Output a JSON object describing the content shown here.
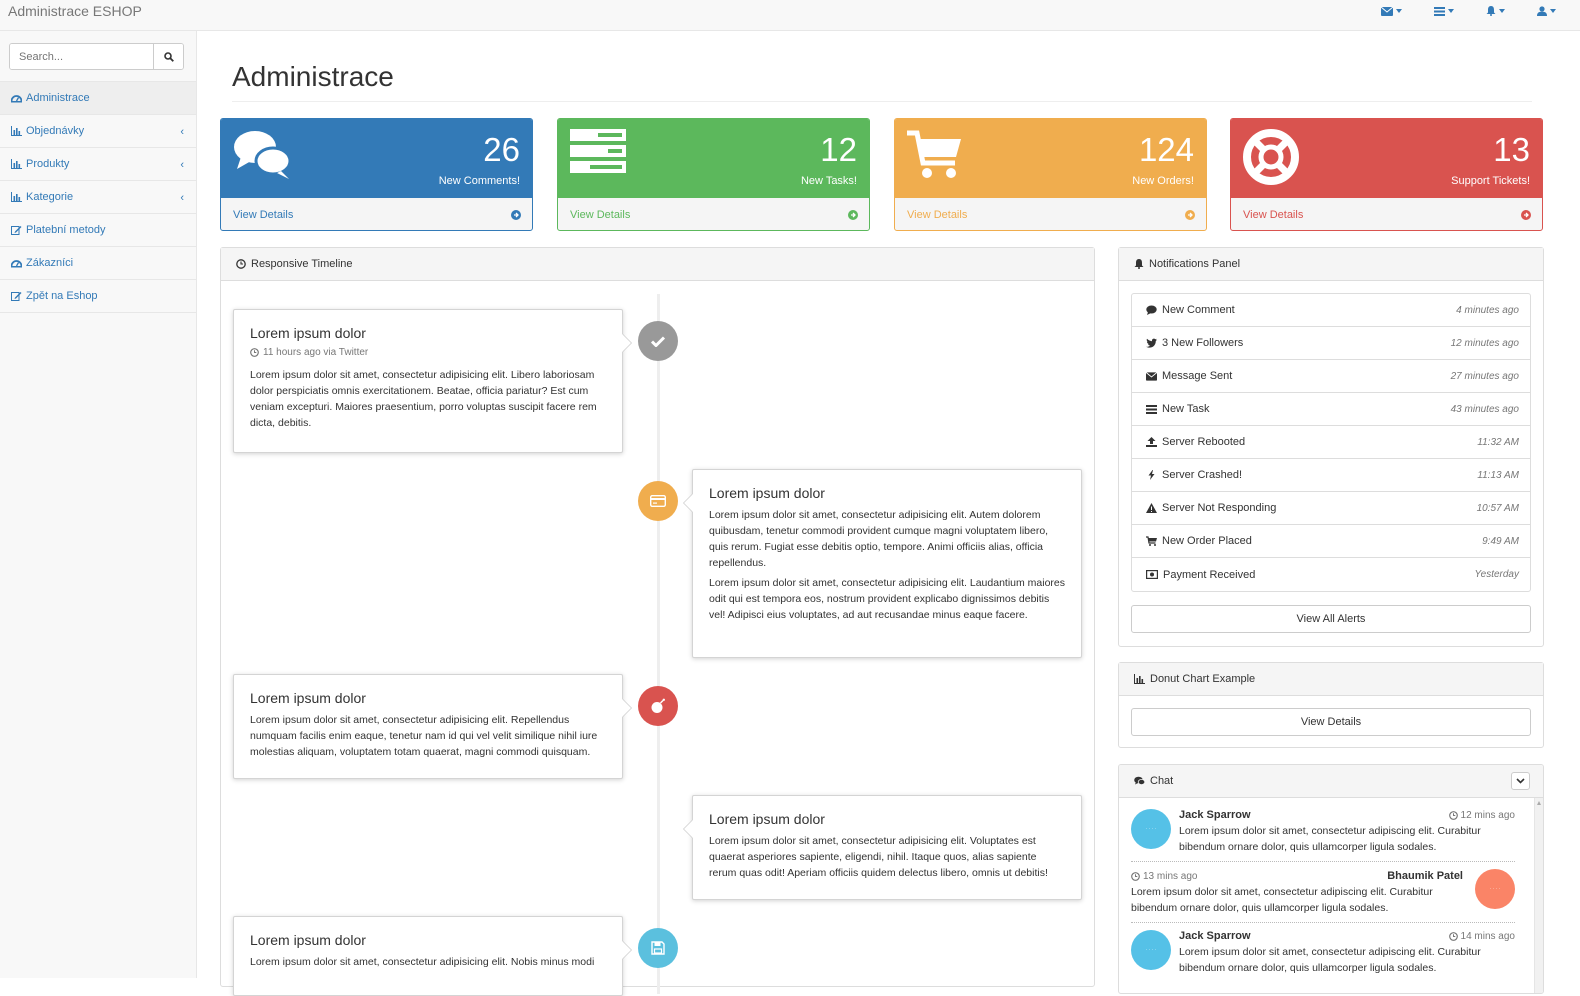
{
  "app": {
    "title": "Administrace ESHOP"
  },
  "topnav": [
    {
      "icon": "envelope-icon"
    },
    {
      "icon": "tasks-icon"
    },
    {
      "icon": "bell-icon"
    },
    {
      "icon": "user-icon"
    }
  ],
  "sidebar": {
    "search_placeholder": "Search...",
    "items": [
      {
        "label": "Administrace",
        "icon": "dashboard-icon",
        "active": true
      },
      {
        "label": "Objednávky",
        "icon": "bar-chart-icon",
        "expandable": true
      },
      {
        "label": "Produkty",
        "icon": "bar-chart-icon",
        "expandable": true
      },
      {
        "label": "Kategorie",
        "icon": "bar-chart-icon",
        "expandable": true
      },
      {
        "label": "Platební metody",
        "icon": "edit-icon"
      },
      {
        "label": "Zákazníci",
        "icon": "dashboard-icon"
      },
      {
        "label": "Zpět na Eshop",
        "icon": "edit-icon"
      }
    ]
  },
  "page": {
    "title": "Administrace"
  },
  "cards": [
    {
      "value": "26",
      "label": "New Comments!",
      "link": "View Details",
      "color": "#337ab7",
      "icon": "comments-icon"
    },
    {
      "value": "12",
      "label": "New Tasks!",
      "link": "View Details",
      "color": "#5cb85c",
      "icon": "tasks-icon"
    },
    {
      "value": "124",
      "label": "New Orders!",
      "link": "View Details",
      "color": "#f0ad4e",
      "icon": "shopping-cart-icon"
    },
    {
      "value": "13",
      "label": "Support Tickets!",
      "link": "View Details",
      "color": "#d9534f",
      "icon": "support-icon"
    }
  ],
  "timeline": {
    "title": "Responsive Timeline",
    "entries": [
      {
        "title": "Lorem ipsum dolor",
        "meta": "11 hours ago via Twitter",
        "paragraphs": [
          "Lorem ipsum dolor sit amet, consectetur adipisicing elit. Libero laboriosam dolor perspiciatis omnis exercitationem. Beatae, officia pariatur? Est cum veniam excepturi. Maiores praesentium, porro voluptas suscipit facere rem dicta, debitis."
        ],
        "badge_color": "#999999",
        "badge_icon": "check-icon"
      },
      {
        "title": "Lorem ipsum dolor",
        "paragraphs": [
          "Lorem ipsum dolor sit amet, consectetur adipisicing elit. Autem dolorem quibusdam, tenetur commodi provident cumque magni voluptatem libero, quis rerum. Fugiat esse debitis optio, tempore. Animi officiis alias, officia repellendus.",
          "Lorem ipsum dolor sit amet, consectetur adipisicing elit. Laudantium maiores odit qui est tempora eos, nostrum provident explicabo dignissimos debitis vel! Adipisci eius voluptates, ad aut recusandae minus eaque facere."
        ],
        "badge_color": "#f0ad4e",
        "badge_icon": "credit-card-icon"
      },
      {
        "title": "Lorem ipsum dolor",
        "paragraphs": [
          "Lorem ipsum dolor sit amet, consectetur adipisicing elit. Repellendus numquam facilis enim eaque, tenetur nam id qui vel velit similique nihil iure molestias aliquam, voluptatem totam quaerat, magni commodi quisquam."
        ],
        "badge_color": "#d9534f",
        "badge_icon": "bomb-icon"
      },
      {
        "title": "Lorem ipsum dolor",
        "paragraphs": [
          "Lorem ipsum dolor sit amet, consectetur adipisicing elit. Voluptates est quaerat asperiores sapiente, eligendi, nihil. Itaque quos, alias sapiente rerum quas odit! Aperiam officiis quidem delectus libero, omnis ut debitis!"
        ]
      },
      {
        "title": "Lorem ipsum dolor",
        "paragraphs": [
          "Lorem ipsum dolor sit amet, consectetur adipisicing elit. Nobis minus modi"
        ],
        "badge_color": "#5bc0de",
        "badge_icon": "save-icon"
      }
    ]
  },
  "notifications": {
    "title": "Notifications Panel",
    "items": [
      {
        "label": "New Comment",
        "time": "4 minutes ago",
        "icon": "comment-icon"
      },
      {
        "label": "3 New Followers",
        "time": "12 minutes ago",
        "icon": "twitter-icon"
      },
      {
        "label": "Message Sent",
        "time": "27 minutes ago",
        "icon": "envelope-icon"
      },
      {
        "label": "New Task",
        "time": "43 minutes ago",
        "icon": "tasks-icon"
      },
      {
        "label": "Server Rebooted",
        "time": "11:32 AM",
        "icon": "upload-icon"
      },
      {
        "label": "Server Crashed!",
        "time": "11:13 AM",
        "icon": "bolt-icon"
      },
      {
        "label": "Server Not Responding",
        "time": "10:57 AM",
        "icon": "warning-icon"
      },
      {
        "label": "New Order Placed",
        "time": "9:49 AM",
        "icon": "shopping-cart-icon"
      },
      {
        "label": "Payment Received",
        "time": "Yesterday",
        "icon": "money-icon"
      }
    ],
    "view_all": "View All Alerts"
  },
  "donut": {
    "title": "Donut Chart Example",
    "button": "View Details"
  },
  "chat": {
    "title": "Chat",
    "messages": [
      {
        "name": "Jack Sparrow",
        "time": "12 mins ago",
        "text": "Lorem ipsum dolor sit amet, consectetur adipiscing elit. Curabitur bibendum ornare dolor, quis ullamcorper ligula sodales.",
        "side": "left",
        "avatar_color": "#55c1e7"
      },
      {
        "name": "Bhaumik Patel",
        "time": "13 mins ago",
        "text": "Lorem ipsum dolor sit amet, consectetur adipiscing elit. Curabitur bibendum ornare dolor, quis ullamcorper ligula sodales.",
        "side": "right",
        "avatar_color": "#fa8467"
      },
      {
        "name": "Jack Sparrow",
        "time": "14 mins ago",
        "text": "Lorem ipsum dolor sit amet, consectetur adipiscing elit. Curabitur bibendum ornare dolor, quis ullamcorper ligula sodales.",
        "side": "left",
        "avatar_color": "#55c1e7"
      }
    ]
  }
}
